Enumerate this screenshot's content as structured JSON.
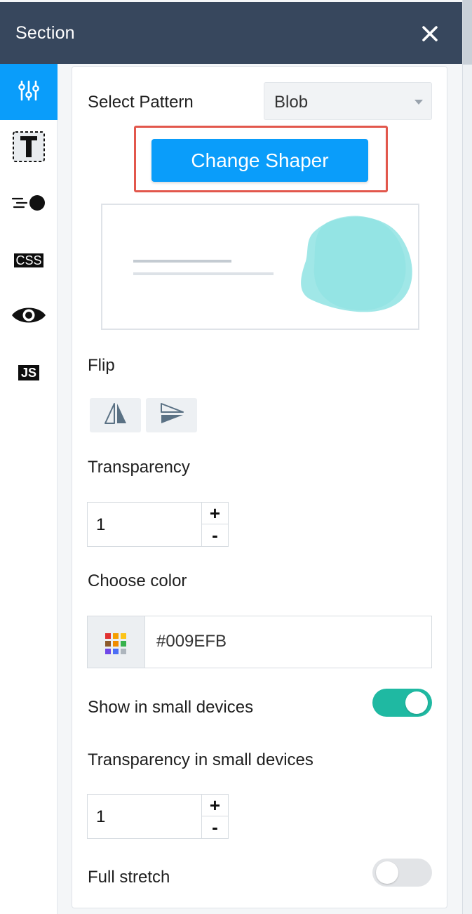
{
  "header": {
    "title": "Section",
    "close_icon": "close-icon"
  },
  "sidebar": {
    "items": [
      {
        "name": "settings-sliders",
        "icon": "sliders-icon",
        "active": true
      },
      {
        "name": "typography",
        "icon": "text-box-icon",
        "active": false
      },
      {
        "name": "animation",
        "icon": "motion-dot-icon",
        "active": false
      },
      {
        "name": "css",
        "label": "CSS",
        "active": false
      },
      {
        "name": "visibility",
        "icon": "eye-icon",
        "active": false
      },
      {
        "name": "js",
        "label": "JS",
        "active": false
      }
    ],
    "accent": "#0a9dfa"
  },
  "panel": {
    "select_pattern": {
      "label": "Select Pattern",
      "value": "Blob"
    },
    "change_shaper_label": "Change Shaper",
    "preview": {
      "blob_color": "#8fe3e3"
    },
    "flip": {
      "label": "Flip"
    },
    "transparency": {
      "label": "Transparency",
      "value": "1",
      "plus": "+",
      "minus": "-"
    },
    "color": {
      "label": "Choose color",
      "value": "#009EFB",
      "palette": [
        "#e03131",
        "#f59f00",
        "#fcc419",
        "#8d5a2b",
        "#f08c00",
        "#37b24d",
        "#7048e8",
        "#4c6ef5",
        "#adb5bd"
      ]
    },
    "show_small": {
      "label": "Show in small devices",
      "on": true
    },
    "transparency_small": {
      "label": "Transparency in small devices",
      "value": "1",
      "plus": "+",
      "minus": "-"
    },
    "full_stretch": {
      "label": "Full stretch",
      "on": false
    }
  }
}
